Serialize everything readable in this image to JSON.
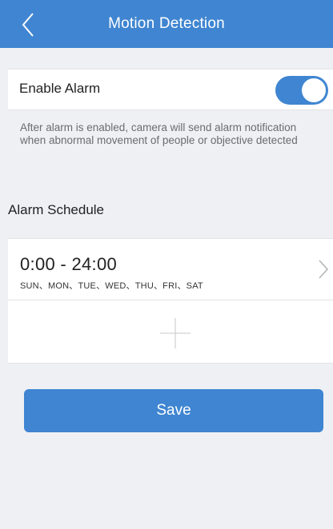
{
  "header": {
    "title": "Motion Detection",
    "back_icon": "chevron-left-icon"
  },
  "alarm": {
    "label": "Enable Alarm",
    "enabled": true,
    "hint": "After alarm is enabled, camera will send alarm notification when abnormal movement of people or objective detected"
  },
  "schedule": {
    "section_title": "Alarm Schedule",
    "items": [
      {
        "time": "0:00 - 24:00",
        "days": "SUN、MON、TUE、WED、THU、FRI、SAT"
      }
    ],
    "add_icon": "plus-icon"
  },
  "actions": {
    "save_label": "Save"
  },
  "colors": {
    "accent": "#3f85d1",
    "background": "#eff0f4",
    "card": "#ffffff",
    "hint_text": "#6b6b70"
  }
}
